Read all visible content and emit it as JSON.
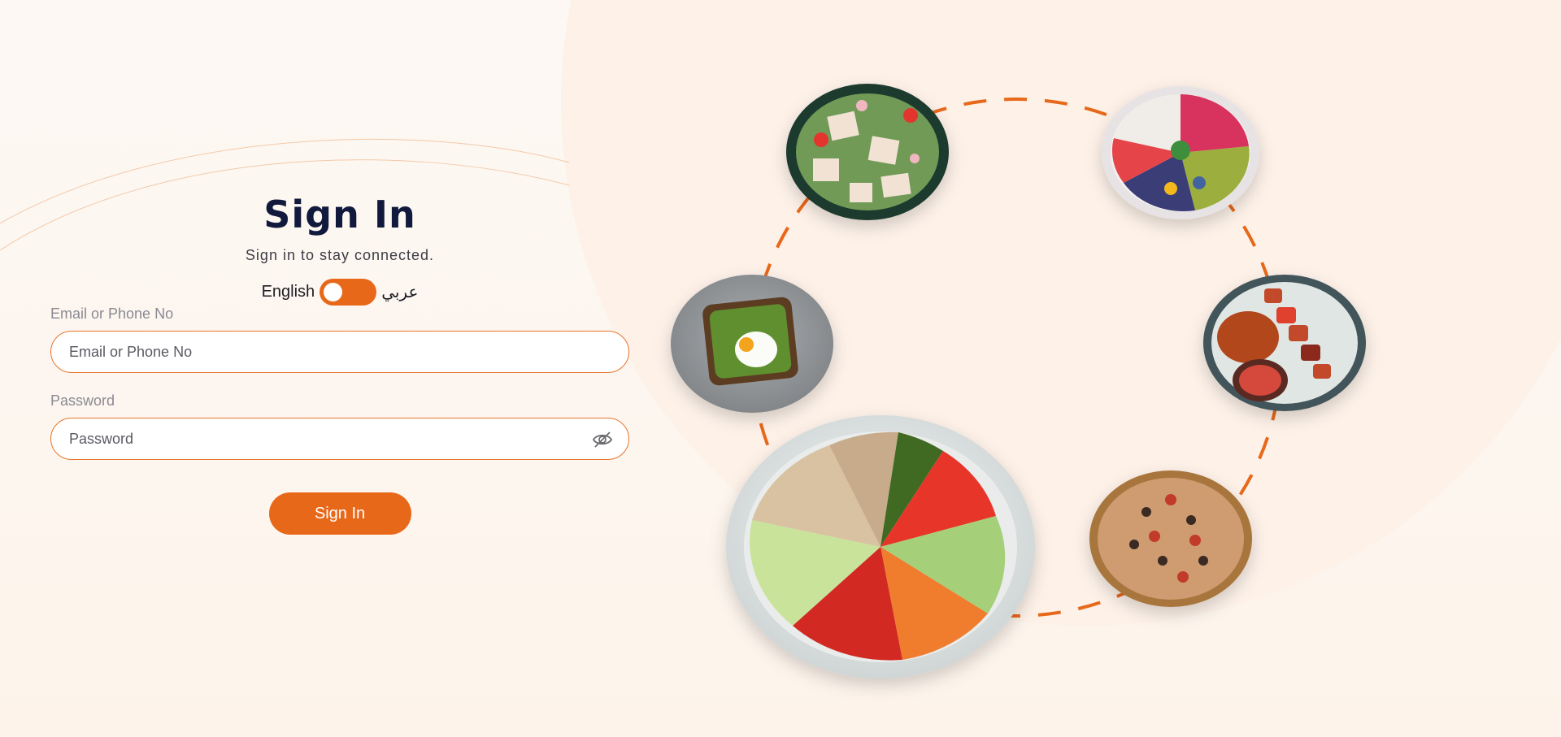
{
  "login": {
    "title": "Sign In",
    "subtitle": "Sign in to stay connected.",
    "language": {
      "left_label": "English",
      "right_label": "عربي",
      "selected": "English"
    },
    "email": {
      "label": "Email or Phone No",
      "placeholder": "Email or Phone No",
      "value": ""
    },
    "password": {
      "label": "Password",
      "placeholder": "Password",
      "value": "",
      "visibility_icon": "eye-off-icon"
    },
    "submit_label": "Sign In"
  },
  "colors": {
    "accent": "#e8681a",
    "title": "#111a3c",
    "background": "#fdf6ef"
  },
  "illustration": {
    "dishes": [
      "salad-bowl",
      "fruit-bowl",
      "avocado-toast",
      "grilled-skewers",
      "vegetable-bowl",
      "pizza"
    ]
  }
}
